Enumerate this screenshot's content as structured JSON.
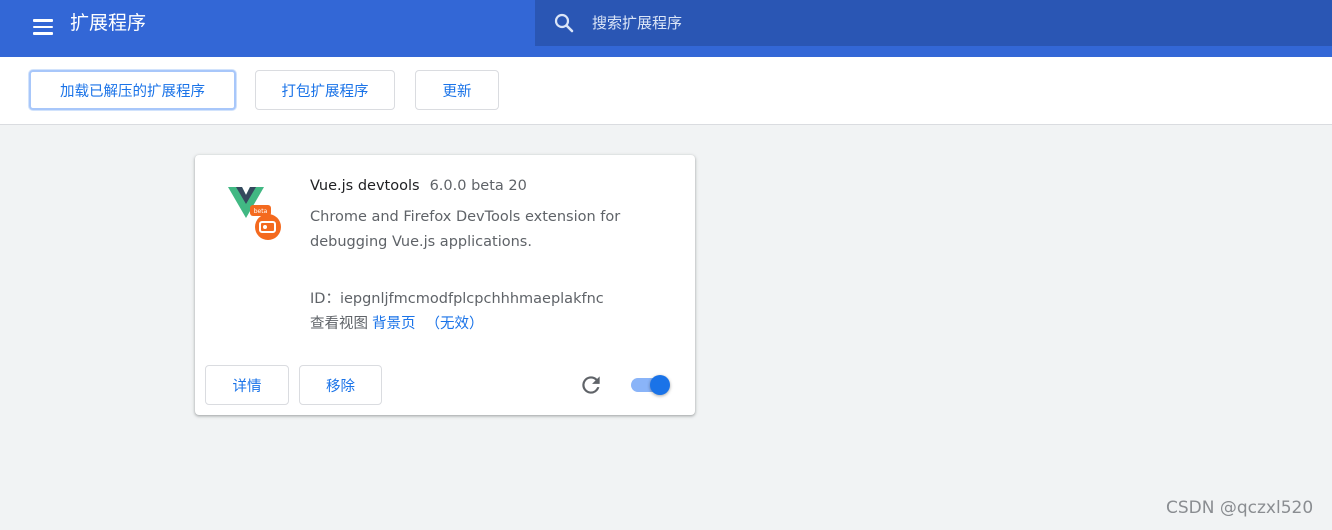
{
  "header": {
    "title": "扩展程序",
    "menu_icon": "hamburger-menu-icon",
    "search": {
      "placeholder": "搜索扩展程序",
      "value": "",
      "icon": "search-icon"
    }
  },
  "toolbar": {
    "load_unpacked_label": "加载已解压的扩展程序",
    "pack_label": "打包扩展程序",
    "update_label": "更新"
  },
  "extension": {
    "icon": "vue-devtools-logo-icon",
    "name": "Vue.js devtools",
    "version": "6.0.0 beta 20",
    "description": "Chrome and Firefox DevTools extension for debugging Vue.js applications.",
    "id_label": "ID：",
    "id_value": "iepgnljfmcmodfplcpchhhmaeplakfnc",
    "views_label": "查看视图",
    "view_link": "背景页",
    "view_status": "（无效）",
    "details_label": "详情",
    "remove_label": "移除",
    "reload_icon": "reload-icon",
    "enabled": true
  },
  "watermark": "CSDN @qczxl520",
  "colors": {
    "header_bg": "#3367d6",
    "search_bg": "#2a56b4",
    "accent": "#1a73e8",
    "page_bg": "#f1f3f4"
  }
}
